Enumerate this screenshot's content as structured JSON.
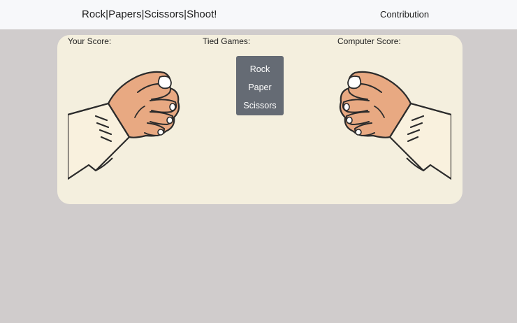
{
  "navbar": {
    "brand": "Rock|Papers|Scissors|Shoot!",
    "contribution_link": "Contribution"
  },
  "scoreboard": {
    "your_score_label": "Your Score:",
    "tied_games_label": "Tied Games:",
    "computer_score_label": "Computer Score:"
  },
  "choices": {
    "rock": "Rock",
    "paper": "Paper",
    "scissors": "Scissors"
  },
  "colors": {
    "skin": "#e8a982",
    "sleeve": "#f9f1de",
    "outline": "#2b2b2b",
    "menu_bg": "#656b74"
  }
}
